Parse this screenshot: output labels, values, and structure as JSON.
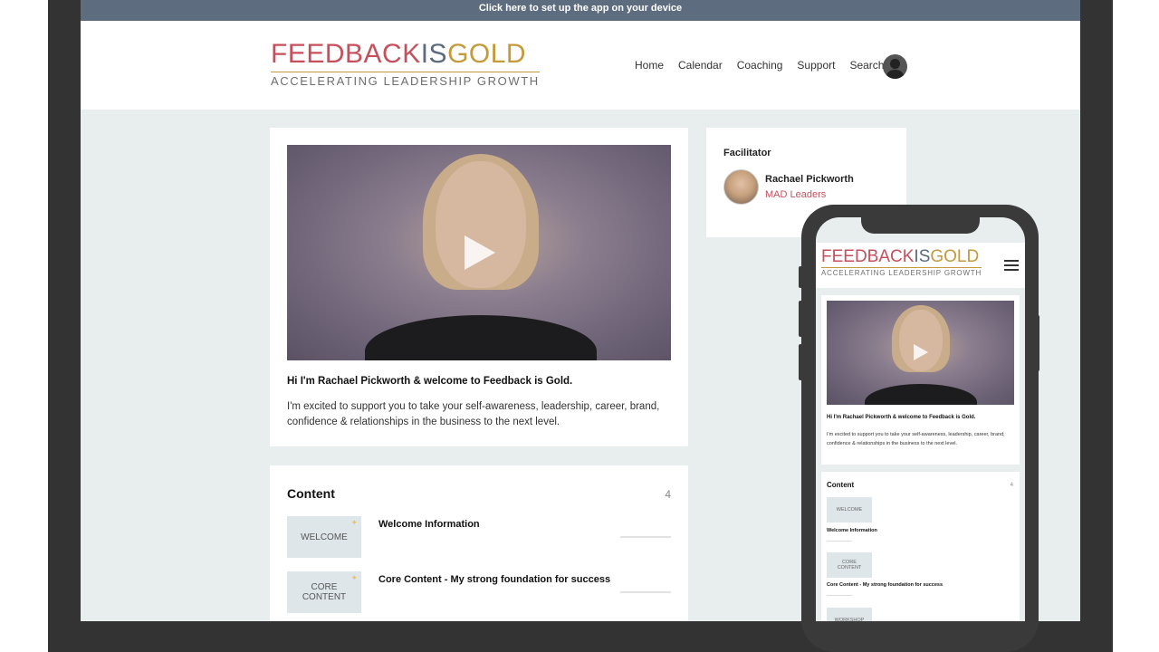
{
  "banner": {
    "text": "Click here to set up the app on your device"
  },
  "logo": {
    "part1": "FEEDBACK",
    "part2": "IS",
    "part3": "GOLD",
    "tagline": "ACCELERATING LEADERSHIP GROWTH"
  },
  "nav": {
    "items": [
      "Home",
      "Calendar",
      "Coaching",
      "Support",
      "Search"
    ]
  },
  "intro": {
    "title": "Hi I'm Rachael Pickworth & welcome to Feedback is Gold.",
    "text": "I'm excited to support you to take your self-awareness, leadership, career, brand, confidence & relationships in the business to the next level."
  },
  "facilitator": {
    "label": "Facilitator",
    "name": "Rachael Pickworth",
    "org": "MAD Leaders"
  },
  "content": {
    "title": "Content",
    "count": "4",
    "items": [
      {
        "thumb": "WELCOME",
        "title": "Welcome Information"
      },
      {
        "thumb": "CORE CONTENT",
        "title": "Core Content - My strong foundation for success"
      },
      {
        "thumb": "WORKSHOP"
      }
    ]
  },
  "colors": {
    "brand_red": "#c5505c",
    "brand_slate": "#5c6b7d",
    "brand_gold": "#c49a3a",
    "banner": "#5d6c7e",
    "frame": "#333333"
  }
}
